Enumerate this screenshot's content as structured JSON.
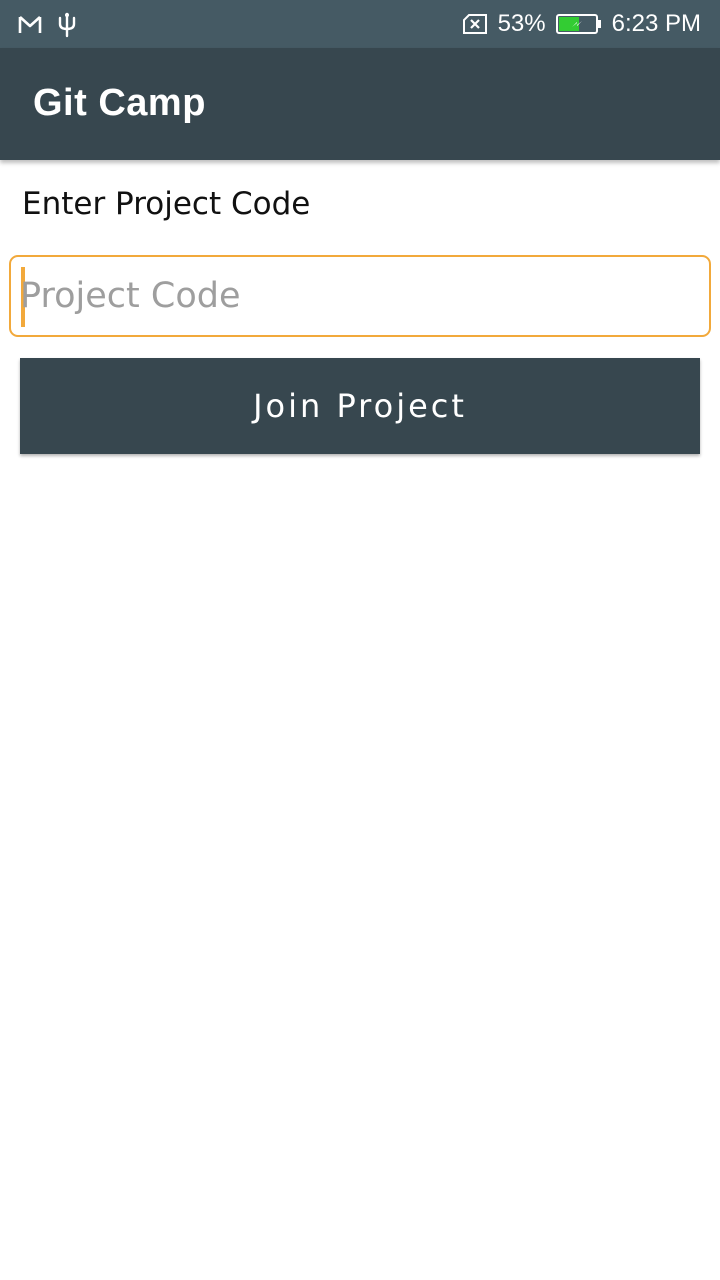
{
  "status_bar": {
    "icons_left": [
      "gmail-icon",
      "usb-icon"
    ],
    "no_sim_icon": "no-sim-icon",
    "battery_percent": "53%",
    "battery_icon": "battery-charging-icon",
    "time": "6:23 PM"
  },
  "app_bar": {
    "title": "Git Camp"
  },
  "form": {
    "label": "Enter Project Code",
    "input_placeholder": "Project Code",
    "input_value": "",
    "join_button_label": "Join Project"
  },
  "colors": {
    "status_bar_bg": "#455a64",
    "app_bar_bg": "#37474f",
    "accent": "#f2a93b",
    "battery_fill": "#33cc33"
  }
}
